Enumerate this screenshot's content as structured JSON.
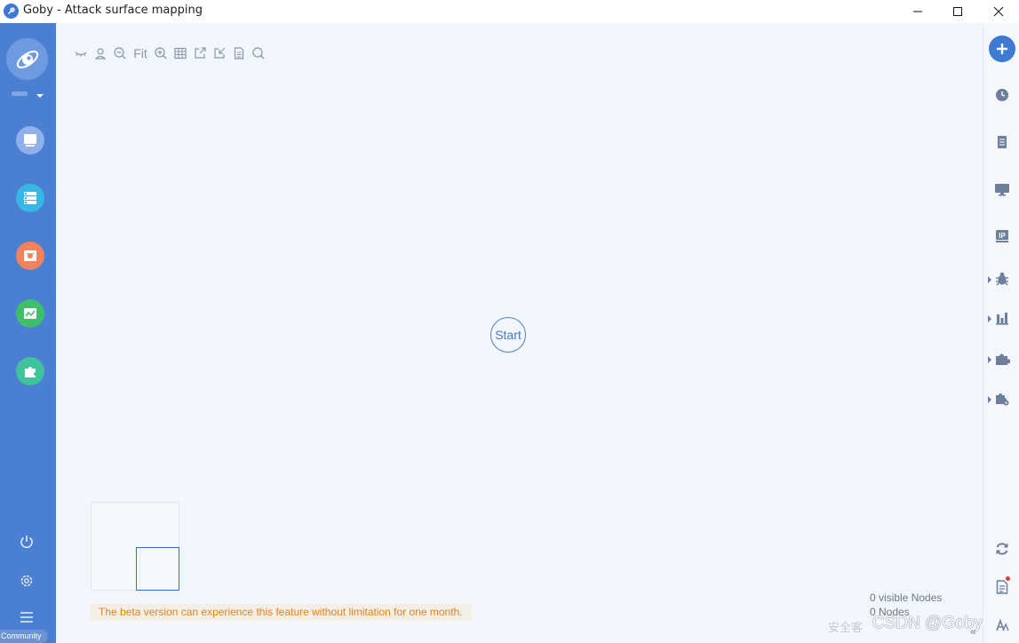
{
  "window": {
    "title": "Goby - Attack surface mapping"
  },
  "left_sidebar": {
    "nav": [
      {
        "name": "nav-scan",
        "icon": "scan-icon",
        "color": "#8fb0ea"
      },
      {
        "name": "nav-assets",
        "icon": "asset-list-icon",
        "color": "#38b6e6"
      },
      {
        "name": "nav-vulnerability",
        "icon": "bug-icon",
        "color": "#f0825e"
      },
      {
        "name": "nav-report",
        "icon": "chart-icon",
        "color": "#3ec06a"
      },
      {
        "name": "nav-extensions",
        "icon": "puzzle-icon",
        "color": "#40c29a"
      }
    ],
    "community_label": "Community"
  },
  "toolbar": {
    "fit_label": "Fit",
    "tools": [
      "hide-icon",
      "user-icon",
      "zoom-out-icon",
      "fit",
      "zoom-in-icon",
      "table-icon",
      "export-icon",
      "import-icon",
      "document-icon",
      "search-icon"
    ]
  },
  "canvas": {
    "start_node_label": "Start"
  },
  "notice": {
    "beta_text": "The beta version can experience this feature without limitation for one month."
  },
  "stats": {
    "visible_nodes": "0 visible Nodes",
    "nodes": "0 Nodes"
  },
  "watermark": {
    "cn_text": "安全客",
    "text": "CSDN @Gobysec"
  },
  "colors": {
    "accent": "#3e7ad3",
    "sidebar": "#4b7fd2",
    "canvas": "#f2f6fd",
    "notice_text": "#e4831a"
  }
}
